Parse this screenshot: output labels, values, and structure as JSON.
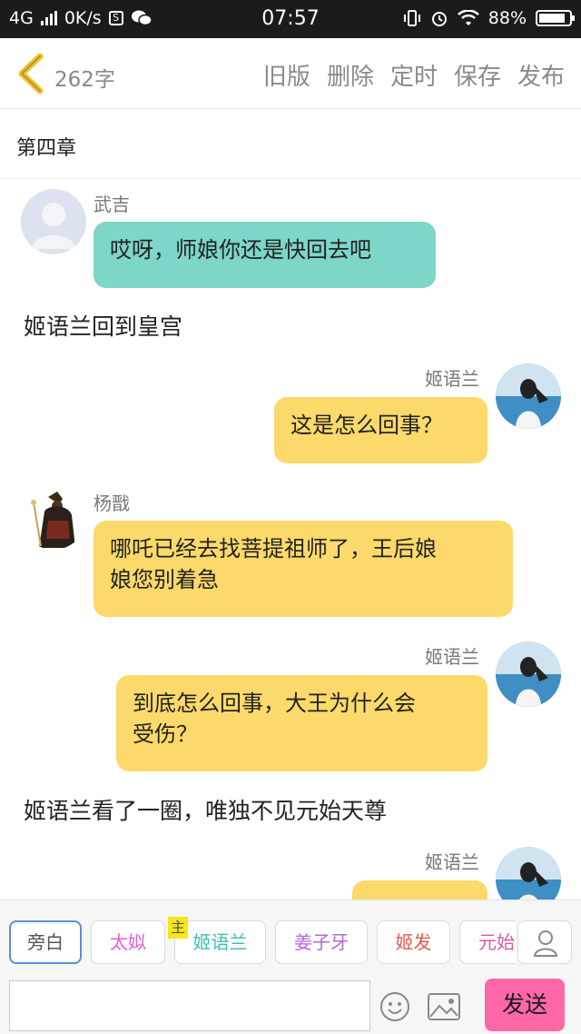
{
  "status_bar": {
    "network": "4G",
    "speed": "0K/s",
    "time": "07:57",
    "battery": "88%",
    "battery_level": 0.88
  },
  "header": {
    "char_count": "262字",
    "actions": [
      "旧版",
      "删除",
      "定时",
      "保存",
      "发布"
    ]
  },
  "chapter_title": "第四章",
  "messages": [
    {
      "type": "left",
      "name": "武吉",
      "text": "哎呀，师娘你还是快回去吧",
      "color": "#7dd6c8"
    },
    {
      "type": "narration",
      "text": "姬语兰回到皇宫"
    },
    {
      "type": "right",
      "name": "姬语兰",
      "text": "这是怎么回事？",
      "color": "#fcd96b"
    },
    {
      "type": "left",
      "name": "杨戬",
      "text_lines": [
        "哪吒已经去找菩提祖师了，王后娘",
        "娘您别着急"
      ],
      "color": "#fcd96b"
    },
    {
      "type": "right",
      "name": "姬语兰",
      "text_lines": [
        "到底怎么回事，大王为什么会",
        "受伤？"
      ],
      "color": "#fcd96b"
    },
    {
      "type": "narration",
      "text": "姬语兰看了一圈，唯独不见元始天尊"
    },
    {
      "type": "right",
      "name": "姬语兰",
      "text": "",
      "color": "#fcd96b"
    }
  ],
  "toolbar": {
    "characters": [
      {
        "label": "旁白",
        "color": "#555555",
        "selected": true
      },
      {
        "label": "太姒",
        "color": "#e35fd2"
      },
      {
        "label": "姬语兰",
        "color": "#3fbfb0",
        "badge": "主"
      },
      {
        "label": "姜子牙",
        "color": "#b566d8"
      },
      {
        "label": "姬发",
        "color": "#e25a4f"
      },
      {
        "label": "元始",
        "color": "#d95aa0"
      }
    ],
    "input_value": "",
    "send_label": "发送"
  }
}
